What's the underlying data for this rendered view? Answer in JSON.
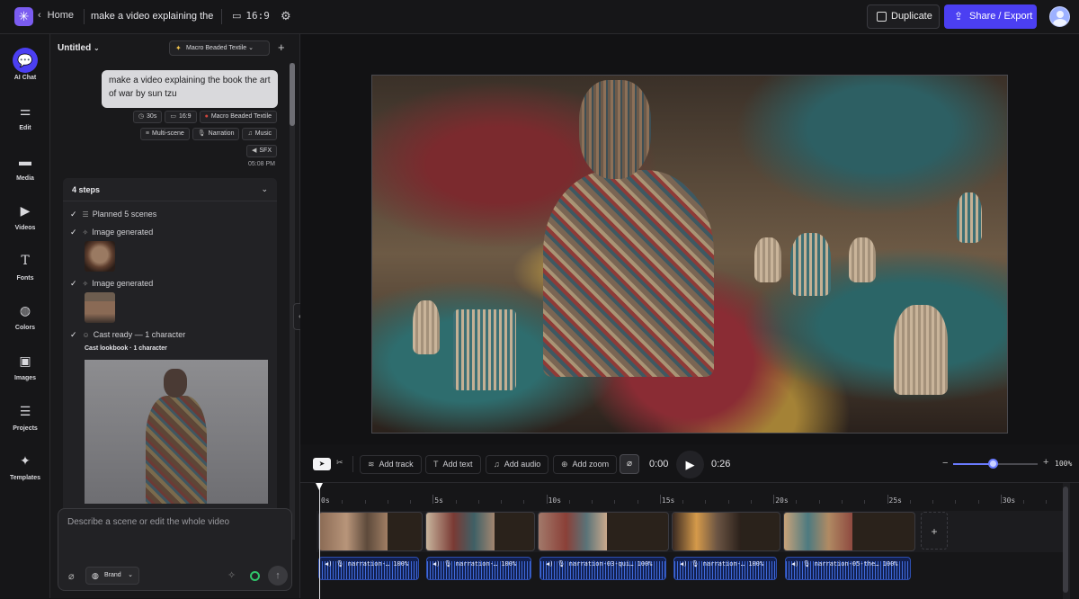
{
  "topbar": {
    "home_label": "Home",
    "project_title": "make a video explaining the bo…",
    "aspect_ratio": "16:9",
    "duplicate_label": "Duplicate",
    "share_label": "Share / Export"
  },
  "rail": {
    "items": [
      {
        "label": "AI Chat",
        "icon": "chat-icon"
      },
      {
        "label": "Edit",
        "icon": "sliders-icon"
      },
      {
        "label": "Media",
        "icon": "folder-icon"
      },
      {
        "label": "Videos",
        "icon": "video-icon"
      },
      {
        "label": "Fonts",
        "icon": "type-icon"
      },
      {
        "label": "Colors",
        "icon": "palette-icon"
      },
      {
        "label": "Images",
        "icon": "image-icon"
      },
      {
        "label": "Projects",
        "icon": "layers-icon"
      },
      {
        "label": "Templates",
        "icon": "sparkle-icon"
      }
    ]
  },
  "chat": {
    "doc_name": "Untitled",
    "style_pill": "Macro Beaded Textile",
    "message": "make a video explaining the book the art of war by sun tzu",
    "chips_row1": [
      "30s",
      "16:9",
      "Macro Beaded Textile"
    ],
    "chips_row2": [
      "Multi-scene",
      "Narration",
      "Music"
    ],
    "chips_row3": [
      "SFX"
    ],
    "timestamp": "05:08 PM",
    "steps_title": "4 steps",
    "steps": [
      "Planned 5 scenes",
      "Image generated",
      "Image generated",
      "Cast ready — 1 character"
    ],
    "cast_lookbook": "Cast lookbook · 1 character",
    "compose_placeholder": "Describe a scene or edit the whole video",
    "brand_label": "Brand"
  },
  "toolbar": {
    "add_track": "Add track",
    "add_text": "Add text",
    "add_audio": "Add audio",
    "add_zoom": "Add zoom",
    "current_time": "0:00",
    "duration": "0:26",
    "zoom_level": "100%",
    "zoom_fraction": 0.48
  },
  "timeline": {
    "ruler_labels": [
      "0s",
      "5s",
      "10s",
      "15s",
      "20s",
      "25s",
      "30s"
    ],
    "audio_clips": [
      {
        "name": "narration-…",
        "volume": "100%"
      },
      {
        "name": "narration-…",
        "volume": "100%"
      },
      {
        "name": "narration-03-qui…",
        "volume": "100%"
      },
      {
        "name": "narration-…",
        "volume": "100%"
      },
      {
        "name": "narration-05-the…",
        "volume": "100%"
      }
    ]
  },
  "colors": {
    "accent": "#4b3ff2",
    "audio_clip": "#122050",
    "waveform": "#4a7dff"
  }
}
